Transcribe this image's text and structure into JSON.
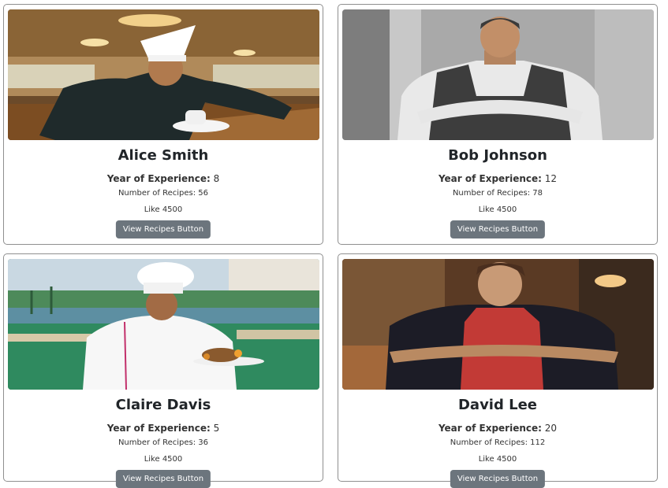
{
  "chefs": [
    {
      "name": "Alice Smith",
      "experience_label": "Year of Experience:",
      "experience": "8",
      "recipes_text": "Number of Recipes: 56",
      "likes_text": "Like 4500",
      "button_label": "View Recipes Button"
    },
    {
      "name": "Bob Johnson",
      "experience_label": "Year of Experience:",
      "experience": "12",
      "recipes_text": "Number of Recipes: 78",
      "likes_text": "Like 4500",
      "button_label": "View Recipes Button"
    },
    {
      "name": "Claire Davis",
      "experience_label": "Year of Experience:",
      "experience": "5",
      "recipes_text": "Number of Recipes: 36",
      "likes_text": "Like 4500",
      "button_label": "View Recipes Button"
    },
    {
      "name": "David Lee",
      "experience_label": "Year of Experience:",
      "experience": "20",
      "recipes_text": "Number of Recipes: 112",
      "likes_text": "Like 4500",
      "button_label": "View Recipes Button"
    }
  ],
  "colors": {
    "button_bg": "#6c757d",
    "card_border": "#8f8f8f"
  }
}
